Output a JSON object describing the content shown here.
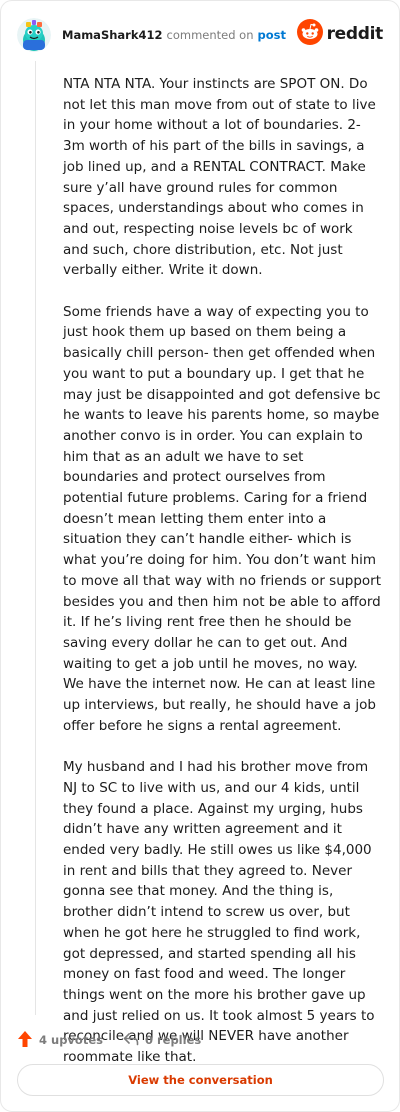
{
  "header": {
    "username": "MamaShark412",
    "commented_text": "commented on",
    "post_link": "post",
    "brand": "reddit",
    "avatar_icon": "snoo-avatar-icon",
    "logo_icon": "reddit-logo-icon"
  },
  "comment": {
    "paragraphs": [
      "NTA NTA NTA. Your instincts are SPOT ON. Do not let this man move from out of state to live in your home without a lot of boundaries. 2-3m worth of his part of the bills in savings, a job lined up, and a RENTAL CONTRACT. Make sure y’all have ground rules for common spaces, understandings about who comes in and out, respecting noise levels bc of work and such, chore distribution, etc. Not just verbally either. Write it down.",
      "Some friends have a way of expecting you to just hook them up based on them being a basically chill person- then get offended when you want to put a boundary up. I get that he may just be disappointed and got defensive bc he wants to leave his parents home, so maybe another convo is in order. You can explain to him that as an adult we have to set boundaries and protect ourselves from potential future problems. Caring for a friend doesn’t mean letting them enter into a situation they can’t handle either- which is what you’re doing for him. You don’t want him to move all that way with no friends or support besides you and then him not be able to afford it. If he’s living rent free then he should be saving every dollar he can to get out. And waiting to get a job until he moves, no way. We have the internet now. He can at least line up interviews, but really, he should have a job offer before he signs a rental agreement.",
      "My husband and I had his brother move from NJ to SC to live with us, and our 4 kids, until they found a place. Against my urging, hubs didn’t have any written agreement and it ended very badly. He still owes us like $4,000 in rent and bills that they agreed to. Never gonna see that money. And the thing is, brother didn’t intend to screw us over, but when he got here he struggled to find work, got depressed, and started spending all his money on fast food and weed. The longer things went on the more his brother gave up and just relied on us. It took almost 5 years to reconcile and we will NEVER have another roommate like that."
    ]
  },
  "actions": {
    "upvotes": "4 upvotes",
    "replies": "0 replies",
    "upvote_icon": "upvote-arrow-icon",
    "reply_icon": "reply-arrow-icon"
  },
  "footer": {
    "view_conversation": "View the conversation"
  },
  "colors": {
    "brand_orange": "#ff4500",
    "upvote_orange": "#ff4500",
    "link_blue": "#0079d3",
    "button_text": "#d93a00",
    "avatar_bg": "#1fc3b9"
  }
}
